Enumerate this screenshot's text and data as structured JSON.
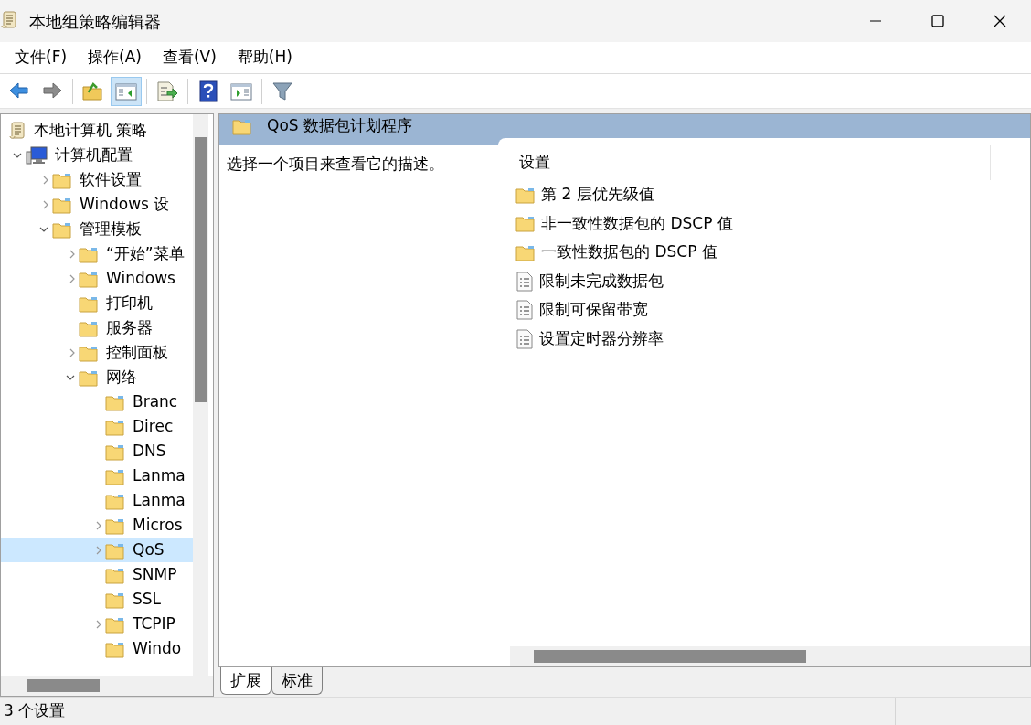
{
  "window": {
    "title": "本地组策略编辑器"
  },
  "menu": [
    "文件(F)",
    "操作(A)",
    "查看(V)",
    "帮助(H)"
  ],
  "toolbar": [
    {
      "kind": "back",
      "pressed": false
    },
    {
      "kind": "forward",
      "pressed": false
    },
    {
      "kind": "sep"
    },
    {
      "kind": "up",
      "pressed": false
    },
    {
      "kind": "tree",
      "pressed": true
    },
    {
      "kind": "sep"
    },
    {
      "kind": "export",
      "pressed": false
    },
    {
      "kind": "sep"
    },
    {
      "kind": "help",
      "pressed": false
    },
    {
      "kind": "pane",
      "pressed": false
    },
    {
      "kind": "sep"
    },
    {
      "kind": "filter",
      "pressed": false
    }
  ],
  "tree": [
    {
      "label": "本地计算机 策略",
      "kind": "policy",
      "selected": false,
      "children": [
        {
          "label": "计算机配置",
          "kind": "computer",
          "expanded": true,
          "selected": false,
          "children": [
            {
              "label": "软件设置",
              "kind": "folder",
              "expanded": false,
              "selected": false
            },
            {
              "label": "Windows 设",
              "kind": "folder",
              "expanded": false,
              "selected": false
            },
            {
              "label": "管理模板",
              "kind": "folder",
              "expanded": true,
              "selected": false,
              "children": [
                {
                  "label": "“开始”菜单",
                  "kind": "folder",
                  "expanded": false,
                  "selected": false
                },
                {
                  "label": "Windows",
                  "kind": "folder",
                  "expanded": false,
                  "selected": false
                },
                {
                  "label": "打印机",
                  "kind": "folder",
                  "selected": false
                },
                {
                  "label": "服务器",
                  "kind": "folder",
                  "selected": false
                },
                {
                  "label": "控制面板",
                  "kind": "folder",
                  "expanded": false,
                  "selected": false
                },
                {
                  "label": "网络",
                  "kind": "folder",
                  "expanded": true,
                  "selected": false,
                  "children": [
                    {
                      "label": "Branc",
                      "kind": "folder",
                      "selected": false
                    },
                    {
                      "label": "Direc",
                      "kind": "folder",
                      "selected": false
                    },
                    {
                      "label": "DNS",
                      "kind": "folder",
                      "selected": false
                    },
                    {
                      "label": "Lanma",
                      "kind": "folder",
                      "selected": false
                    },
                    {
                      "label": "Lanma",
                      "kind": "folder",
                      "selected": false
                    },
                    {
                      "label": "Micros",
                      "kind": "folder",
                      "expanded": false,
                      "selected": false
                    },
                    {
                      "label": "QoS",
                      "kind": "folder",
                      "expanded": false,
                      "selected": true
                    },
                    {
                      "label": "SNMP",
                      "kind": "folder",
                      "selected": false
                    },
                    {
                      "label": "SSL",
                      "kind": "folder",
                      "selected": false
                    },
                    {
                      "label": "TCPIP",
                      "kind": "folder",
                      "expanded": false,
                      "selected": false
                    },
                    {
                      "label": "Windo",
                      "kind": "folder",
                      "selected": false
                    }
                  ]
                }
              ]
            }
          ]
        }
      ]
    }
  ],
  "details": {
    "title": "QoS 数据包计划程序",
    "description": "选择一个项目来查看它的描述。",
    "column": "设置",
    "items": [
      {
        "kind": "folder",
        "label": "第 2 层优先级值"
      },
      {
        "kind": "folder",
        "label": "非一致性数据包的 DSCP 值"
      },
      {
        "kind": "folder",
        "label": "一致性数据包的 DSCP 值"
      },
      {
        "kind": "setting",
        "label": "限制未完成数据包"
      },
      {
        "kind": "setting",
        "label": "限制可保留带宽"
      },
      {
        "kind": "setting",
        "label": "设置定时器分辨率"
      }
    ]
  },
  "view_tabs": [
    {
      "label": "扩展",
      "selected": true
    },
    {
      "label": "标准",
      "selected": false
    }
  ],
  "status_bar": "3 个设置"
}
